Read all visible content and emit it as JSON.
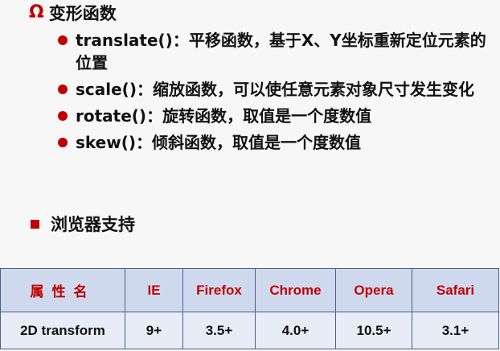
{
  "section": {
    "icon": "omega-icon",
    "icon_glyph": "Ω",
    "title": "变形函数"
  },
  "bullets": [
    {
      "text": "translate()：平移函数，基于X、Y坐标重新定位元素的位置"
    },
    {
      "text": "scale()：缩放函数，可以使任意元素对象尺寸发生变化"
    },
    {
      "text": "rotate()：旋转函数，取值是一个度数值"
    },
    {
      "text": "skew()：倾斜函数，取值是一个度数值"
    }
  ],
  "support": {
    "heading": "浏览器支持"
  },
  "table": {
    "headers": [
      "属性名",
      "IE",
      "Firefox",
      "Chrome",
      "Opera",
      "Safari"
    ],
    "rows": [
      [
        "2D transform",
        "9+",
        "3.5+",
        "4.0+",
        "10.5+",
        "3.1+"
      ]
    ]
  },
  "colors": {
    "accent": "#c00000",
    "table_header_bg": "#cfd9ee",
    "table_body_bg": "#e7ecf7",
    "table_border": "#4a5f8a",
    "page_bg": "#f7f7f7"
  }
}
